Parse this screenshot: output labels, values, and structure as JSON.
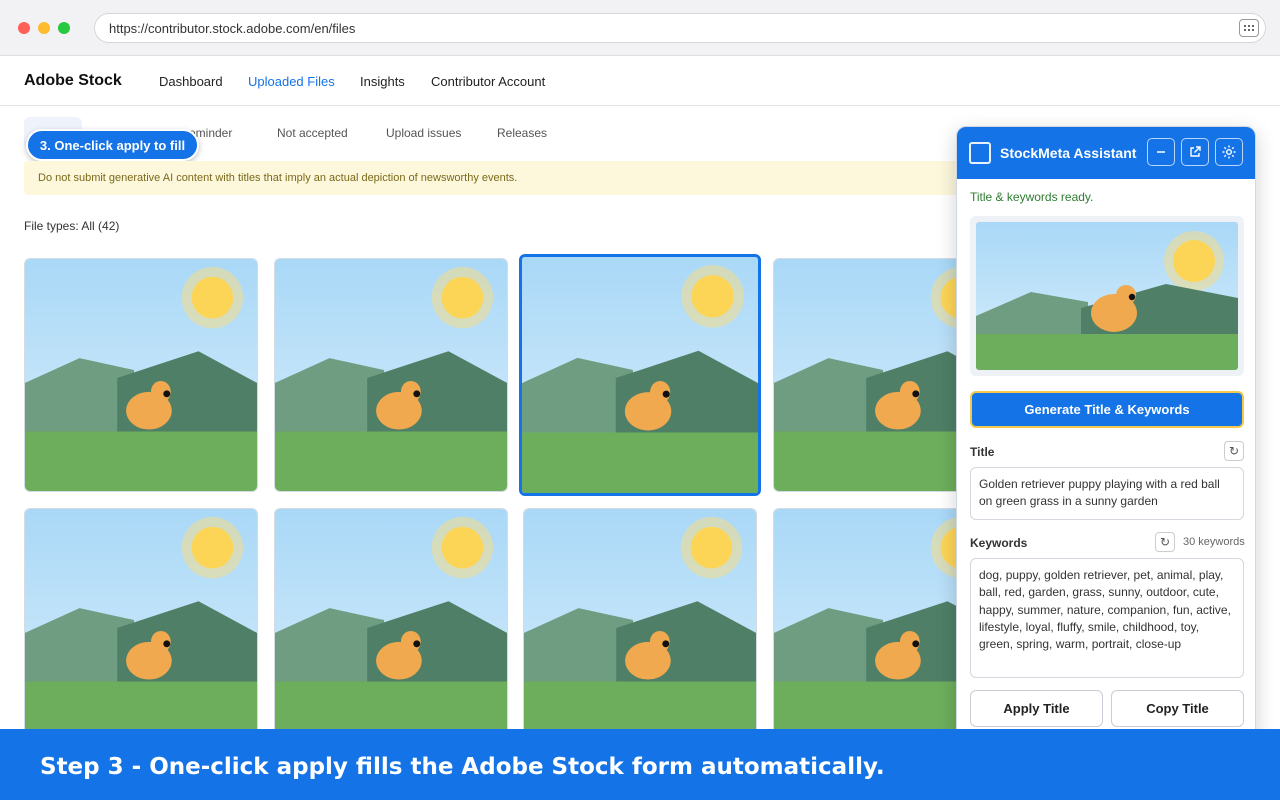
{
  "browser": {
    "url": "https://contributor.stock.adobe.com/en/files"
  },
  "nav": {
    "brand": "Adobe Stock",
    "links": [
      "Dashboard",
      "Uploaded Files",
      "Insights",
      "Contributor Account"
    ],
    "active": "Uploaded Files"
  },
  "subtabs": [
    "eminder",
    "Not accepted",
    "Upload issues",
    "Releases"
  ],
  "tooltip_pill": "3. One-click apply to fill",
  "warning": "Do not submit generative AI content with titles that imply an actual depiction of newsworthy events.",
  "file_types": "File types: All (42)",
  "thumbnails": {
    "count": 8,
    "selected_index": 2
  },
  "colors": {
    "accent": "#1473e6",
    "ready_green": "#2e7d32",
    "highlight": "#f2c94c"
  },
  "panel": {
    "title": "StockMeta Assistant",
    "header_icons": [
      "minimize-icon",
      "external-link-icon",
      "gear-icon"
    ],
    "status": "Title & keywords ready.",
    "generate_label": "Generate Title & Keywords",
    "title_label": "Title",
    "title_value": "Golden retriever puppy playing with a red ball on green grass in a sunny garden",
    "keywords_label": "Keywords",
    "keywords_count": "30 keywords",
    "keywords_value": "dog, puppy, golden retriever, pet, animal, play, ball, red, garden, grass, sunny, outdoor, cute, happy, summer, nature, companion, fun, active, lifestyle, loyal, fluffy, smile, childhood, toy, green, spring, warm, portrait, close-up",
    "apply_title": "Apply Title",
    "copy_title": "Copy Title"
  },
  "banner": "Step 3 - One-click apply fills the Adobe Stock form automatically."
}
